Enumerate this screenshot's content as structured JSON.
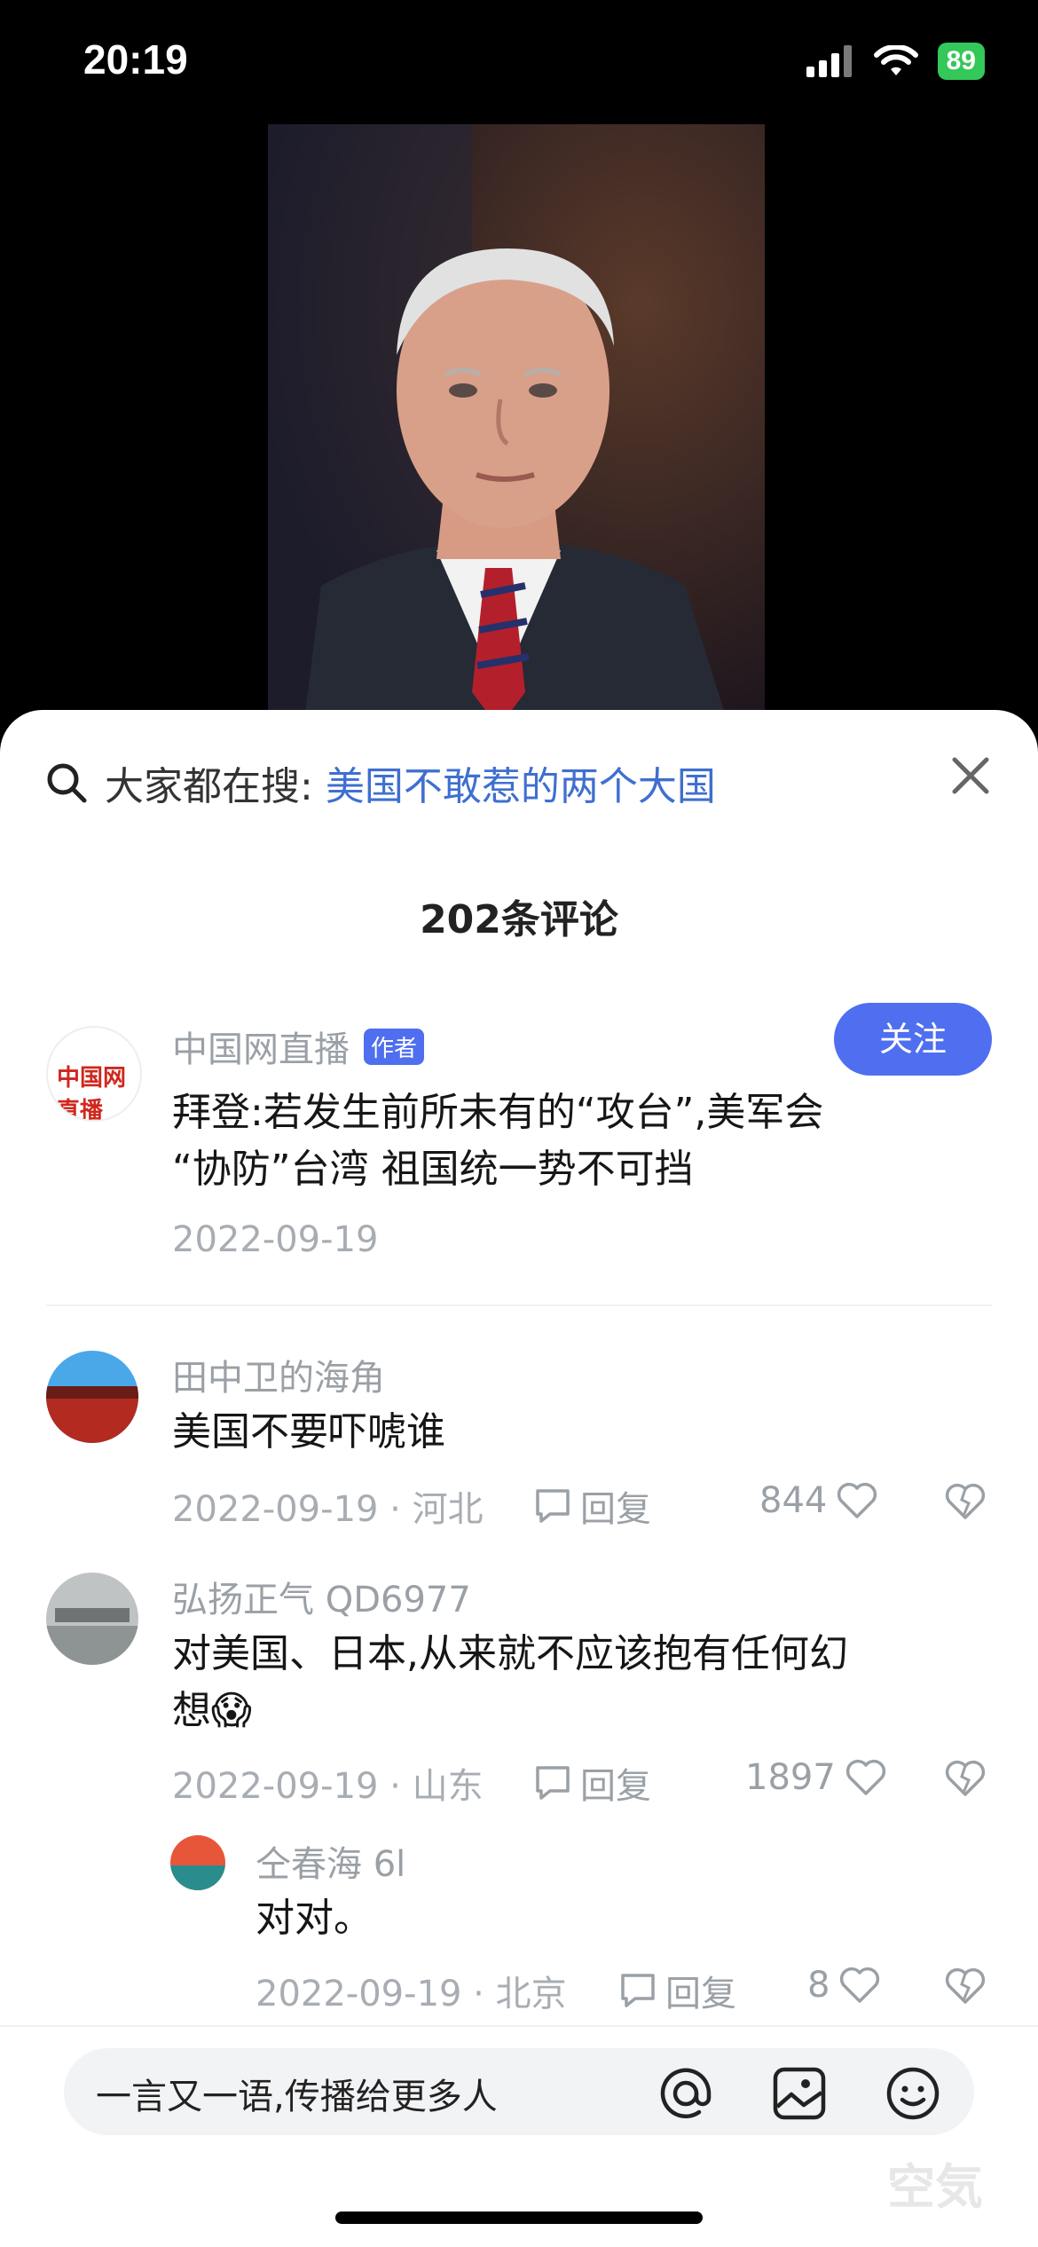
{
  "status": {
    "time": "20:19",
    "battery": "89"
  },
  "search": {
    "label": "大家都在搜:",
    "term": "美国不敢惹的两个大国"
  },
  "comments_count": "202条评论",
  "post": {
    "author": "中国网直播",
    "badge": "作者",
    "follow": "关注",
    "text_line1": "拜登:若发生前所未有的“攻台”,美军会",
    "text_line2": "“协防”台湾 祖国统一势不可挡",
    "date": "2022-09-19",
    "avatar_text": "中国网 直播"
  },
  "comments": [
    {
      "user": "田中卫的海角",
      "text": "美国不要吓唬谁",
      "meta": "2022-09-19 · 河北",
      "reply": "回复",
      "likes": "844"
    },
    {
      "user": "弘扬正气 QD6977",
      "text_line1": "对美国、日本,从来就不应该抱有任何幻",
      "text_line2": "想😱",
      "meta": "2022-09-19 · 山东",
      "reply": "回复",
      "likes": "1897"
    },
    {
      "user": "仝春海 6l",
      "text": "对对。",
      "meta": "2022-09-19 · 北京",
      "reply": "回复",
      "likes": "8"
    }
  ],
  "input": {
    "placeholder": "一言又一语,传播给更多人"
  },
  "watermark": "空気",
  "colors": {
    "accent": "#4f6ff0",
    "link": "#3f6fd0"
  },
  "icons": [
    "search-icon",
    "close-icon",
    "comment-icon",
    "heart-icon",
    "dislike-heart-icon",
    "at-icon",
    "image-icon",
    "emoji-icon",
    "signal-icon",
    "wifi-icon"
  ]
}
